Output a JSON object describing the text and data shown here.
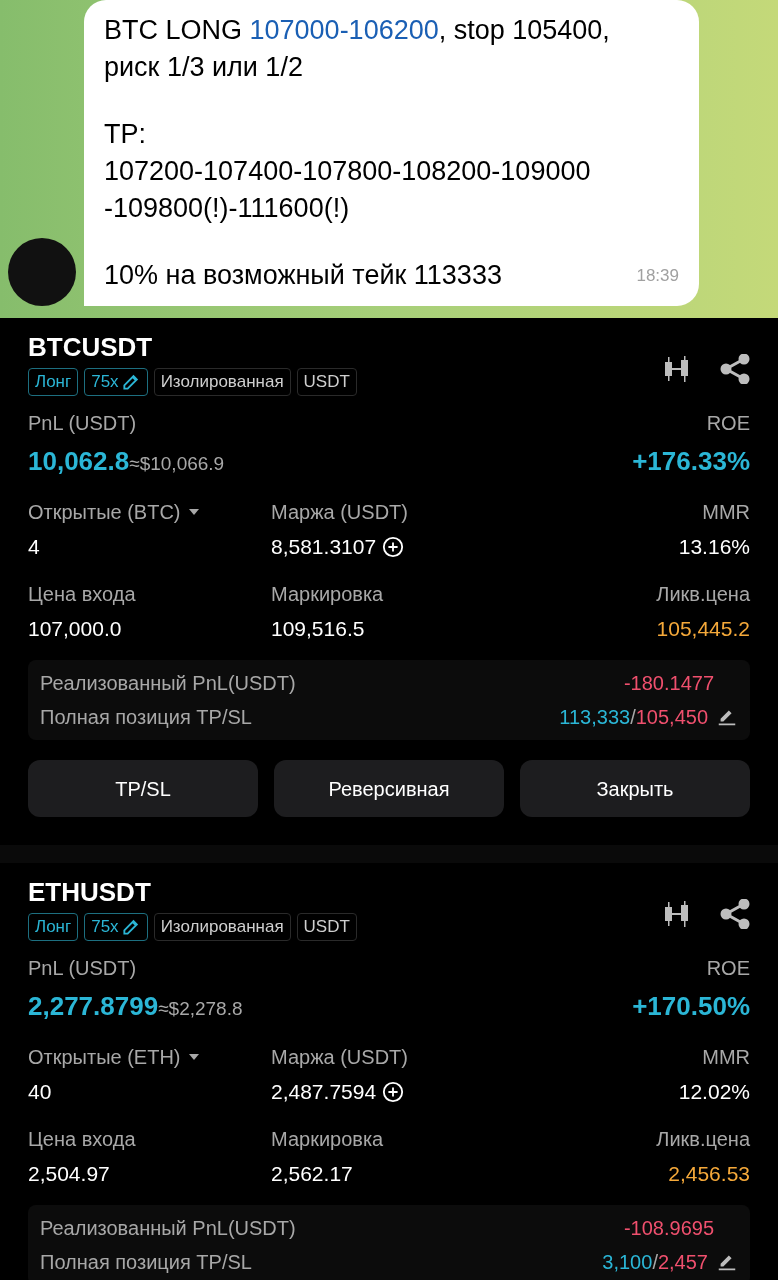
{
  "chat": {
    "message": {
      "paragraphs": [
        {
          "lines": [
            [
              {
                "kind": "text",
                "text": "BTC LONG "
              },
              {
                "kind": "link",
                "text": "107000-106200"
              },
              {
                "kind": "text",
                "text": ", stop 105400,"
              }
            ],
            [
              {
                "kind": "text",
                "text": "риск 1/3 или 1/2"
              }
            ]
          ]
        },
        {
          "lines": [
            [
              {
                "kind": "text",
                "text": "TP:"
              }
            ],
            [
              {
                "kind": "text",
                "text": "107200-107400-107800-108200-109000"
              }
            ],
            [
              {
                "kind": "text",
                "text": "-109800(!)-111600(!)"
              }
            ]
          ]
        },
        {
          "lines": [
            [
              {
                "kind": "text",
                "text": "10% на возможный тейк 113333"
              }
            ]
          ]
        }
      ],
      "time": "18:39"
    }
  },
  "positions": [
    {
      "symbol": "BTCUSDT",
      "tags": [
        {
          "kind": "accent",
          "text": "Лонг",
          "editable": false
        },
        {
          "kind": "accent",
          "text": "75x",
          "editable": true
        },
        {
          "kind": "plain",
          "text": "Изолированная",
          "editable": false
        },
        {
          "kind": "plain",
          "text": "USDT",
          "editable": false
        }
      ],
      "pnl_label": "PnL (USDT)",
      "pnl": "10,062.8",
      "pnl_usd": "≈$10,066.9",
      "roe_label": "ROE",
      "roe": "+176.33%",
      "stats": [
        {
          "label": "Открытые (BTC)",
          "value": "4",
          "kind": "dropdown",
          "color": "#ffffff"
        },
        {
          "label": "Маржа (USDT)",
          "value": "8,581.3107",
          "kind": "add",
          "color": "#ffffff"
        },
        {
          "label": "MMR",
          "value": "13.16%",
          "kind": "plain",
          "color": "#ffffff"
        },
        {
          "label": "Цена входа",
          "value": "107,000.0",
          "kind": "plain",
          "color": "#ffffff"
        },
        {
          "label": "Маркировка",
          "value": "109,516.5",
          "kind": "plain",
          "color": "#ffffff"
        },
        {
          "label": "Ликв.цена",
          "value": "105,445.2",
          "kind": "plain",
          "color": "#f5a93a"
        }
      ],
      "realized_label": "Реализованный PnL(USDT)",
      "realized": "-180.1477",
      "tpsl_label": "Полная позиция TP/SL",
      "tp": "113,333",
      "separator": "/",
      "sl": "105,450",
      "buttons": [
        "TP/SL",
        "Реверсивная",
        "Закрыть"
      ]
    },
    {
      "symbol": "ETHUSDT",
      "tags": [
        {
          "kind": "accent",
          "text": "Лонг",
          "editable": false
        },
        {
          "kind": "accent",
          "text": "75x",
          "editable": true
        },
        {
          "kind": "plain",
          "text": "Изолированная",
          "editable": false
        },
        {
          "kind": "plain",
          "text": "USDT",
          "editable": false
        }
      ],
      "pnl_label": "PnL (USDT)",
      "pnl": "2,277.8799",
      "pnl_usd": "≈$2,278.8",
      "roe_label": "ROE",
      "roe": "+170.50%",
      "stats": [
        {
          "label": "Открытые (ETH)",
          "value": "40",
          "kind": "dropdown",
          "color": "#ffffff"
        },
        {
          "label": "Маржа (USDT)",
          "value": "2,487.7594",
          "kind": "add",
          "color": "#ffffff"
        },
        {
          "label": "MMR",
          "value": "12.02%",
          "kind": "plain",
          "color": "#ffffff"
        },
        {
          "label": "Цена входа",
          "value": "2,504.97",
          "kind": "plain",
          "color": "#ffffff"
        },
        {
          "label": "Маркировка",
          "value": "2,562.17",
          "kind": "plain",
          "color": "#ffffff"
        },
        {
          "label": "Ликв.цена",
          "value": "2,456.53",
          "kind": "plain",
          "color": "#f5a93a"
        }
      ],
      "realized_label": "Реализованный PnL(USDT)",
      "realized": "-108.9695",
      "tpsl_label": "Полная позиция TP/SL",
      "tp": "3,100",
      "separator": "/",
      "sl": "2,457"
    }
  ]
}
